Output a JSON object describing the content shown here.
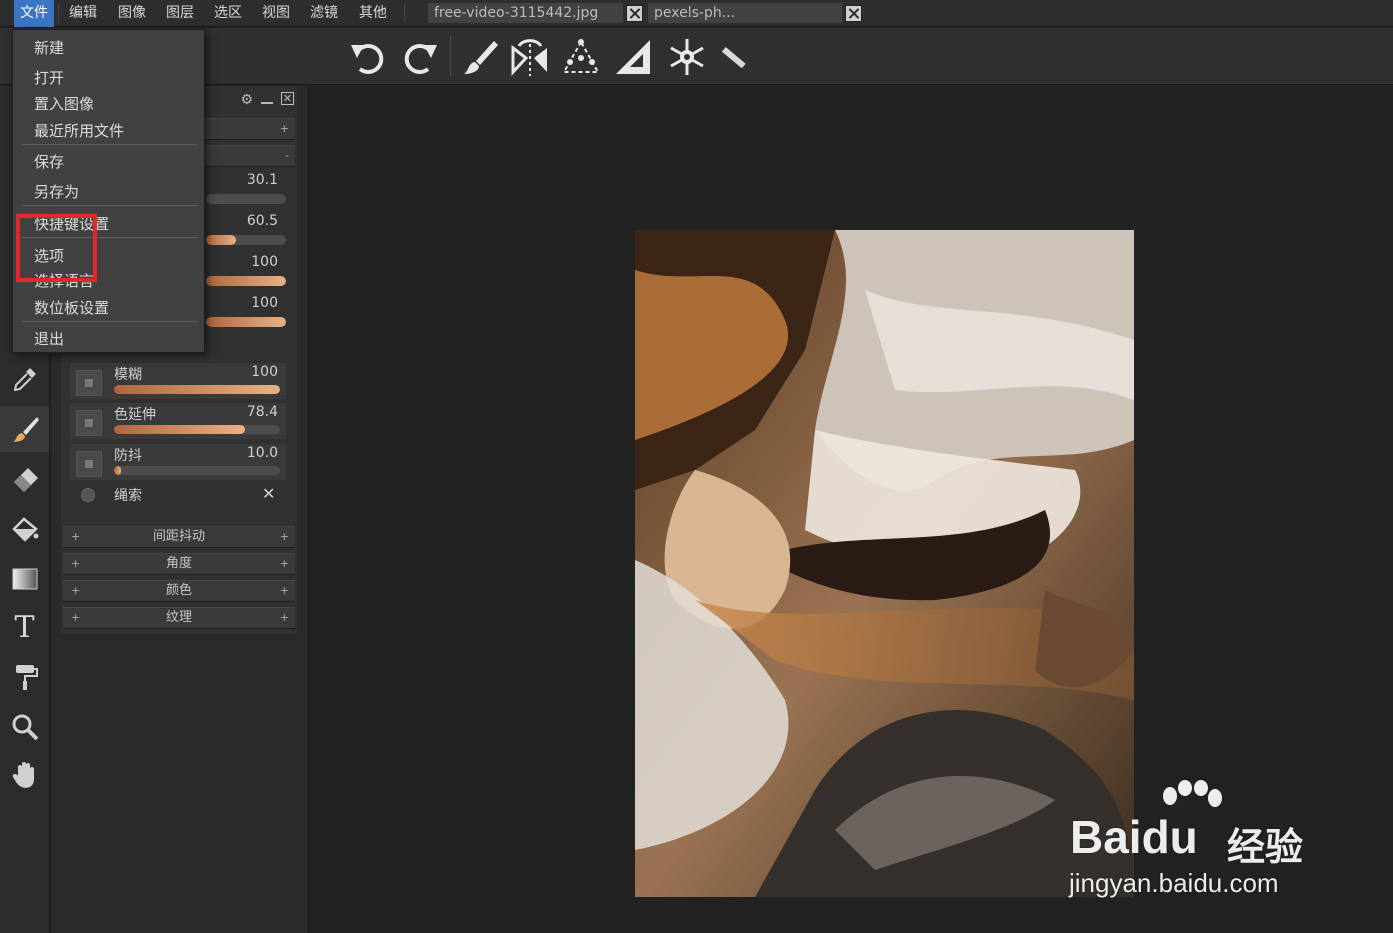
{
  "menubar": {
    "items": [
      "文件",
      "编辑",
      "图像",
      "图层",
      "选区",
      "视图",
      "滤镜",
      "其他"
    ],
    "active": "文件",
    "tabs": [
      "free-video-3115442.jpg",
      "pexels-ph..."
    ]
  },
  "toolbar": {
    "icons": [
      "undo-icon",
      "redo-icon",
      "brush-tool-icon",
      "symmetry-icon",
      "perspective-icon",
      "ruler-triangle-icon",
      "snowflake-icon",
      "ruler-icon"
    ]
  },
  "file_menu": {
    "items": [
      "新建",
      "打开",
      "置入图像",
      "最近所用文件",
      "保存",
      "另存为",
      "快捷键设置",
      "选项",
      "选择语言",
      "数位板设置",
      "退出"
    ],
    "highlighted": "选项"
  },
  "panel": {
    "raw_values": [
      "30.1",
      "60.5",
      "100",
      "100"
    ],
    "raw_levels": [
      0.0,
      0.38,
      1.0,
      1.0
    ],
    "sliders": [
      {
        "label": "模糊",
        "value": "100",
        "level": 1.0
      },
      {
        "label": "色延伸",
        "value": "78.4",
        "level": 0.79
      },
      {
        "label": "防抖",
        "value": "10.0",
        "level": 0.04
      }
    ],
    "lasso_label": "绳索",
    "sections": [
      "间距抖动",
      "角度",
      "颜色",
      "纹理"
    ]
  },
  "left_tools": [
    "eyedropper-icon",
    "brush-icon",
    "eraser-icon",
    "fill-bucket-icon",
    "gradient-icon",
    "text-icon",
    "paint-roller-icon",
    "zoom-icon",
    "hand-icon"
  ],
  "watermark": {
    "brand": "Baidu",
    "suffix": "经验",
    "url": "jingyan.baidu.com"
  },
  "colors": {
    "accent": "#3a76c4",
    "highlight_box": "#e2282b",
    "slider_fill": "#e6b186"
  }
}
